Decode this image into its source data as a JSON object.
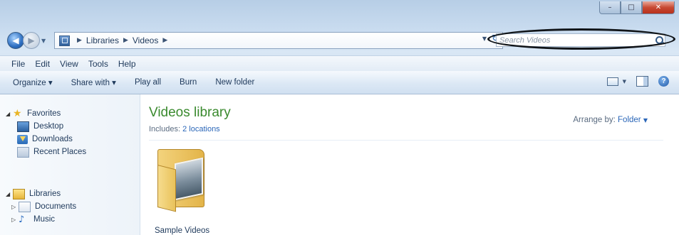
{
  "breadcrumbs": [
    "Libraries",
    "Videos"
  ],
  "search": {
    "placeholder": "Search Videos"
  },
  "menu": [
    "File",
    "Edit",
    "View",
    "Tools",
    "Help"
  ],
  "toolbar": {
    "organize": "Organize ▾",
    "share_with": "Share with ▾",
    "play_all": "Play all",
    "burn": "Burn",
    "new_folder": "New folder"
  },
  "nav": {
    "favorites": "Favorites",
    "desktop": "Desktop",
    "downloads": "Downloads",
    "recent_places": "Recent Places",
    "libraries": "Libraries",
    "documents": "Documents",
    "music": "Music"
  },
  "content": {
    "title": "Videos library",
    "includes_label": "Includes:",
    "locations_link": "2 locations",
    "arrange_label": "Arrange by:",
    "arrange_value": "Folder",
    "items": [
      {
        "name": "Sample Videos"
      }
    ]
  },
  "colors": {
    "library_title": "#3a8a2e",
    "link": "#2a66b8",
    "close_button": "#c84a33"
  }
}
